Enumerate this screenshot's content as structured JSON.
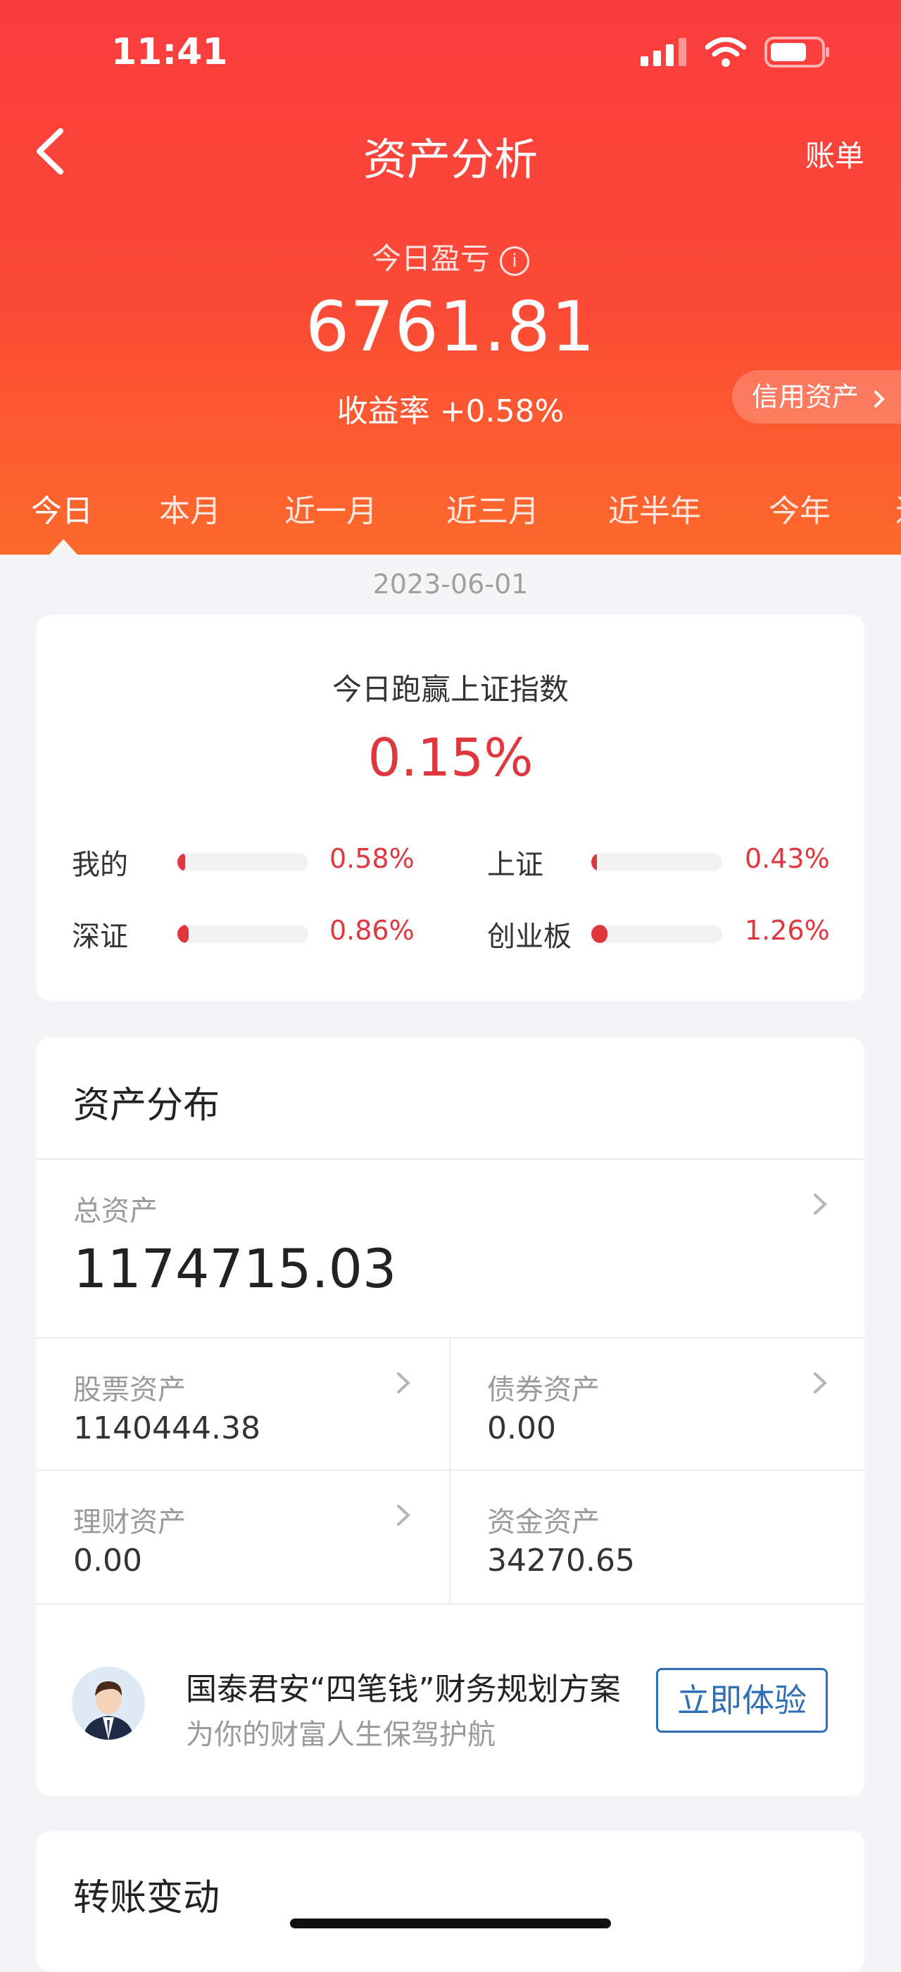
{
  "status_bar": {
    "time": "11:41"
  },
  "nav": {
    "title": "资产分析",
    "bill": "账单"
  },
  "summary": {
    "today_label": "今日盈亏",
    "info_glyph": "i",
    "today_value": "6761.81",
    "rate_text": "收益率 +0.58%",
    "credit_label": "信用资产"
  },
  "tabs": [
    {
      "label": "今日",
      "active": true
    },
    {
      "label": "本月"
    },
    {
      "label": "近一月"
    },
    {
      "label": "近三月"
    },
    {
      "label": "近半年"
    },
    {
      "label": "今年"
    },
    {
      "label": "近"
    }
  ],
  "date": "2023-06-01",
  "comparison": {
    "title": "今日跑赢上证指数",
    "value": "0.15%",
    "items": [
      {
        "label": "我的",
        "pct": "0.58%",
        "fill": 0.058
      },
      {
        "label": "上证",
        "pct": "0.43%",
        "fill": 0.043
      },
      {
        "label": "深证",
        "pct": "0.86%",
        "fill": 0.086
      },
      {
        "label": "创业板",
        "pct": "1.26%",
        "fill": 0.126
      }
    ]
  },
  "assets": {
    "title": "资产分布",
    "total_label": "总资产",
    "total_value": "1174715.03",
    "stock_label": "股票资产",
    "stock_value": "1140444.38",
    "bond_label": "债券资产",
    "bond_value": "0.00",
    "wealth_label": "理财资产",
    "wealth_value": "0.00",
    "cash_label": "资金资产",
    "cash_value": "34270.65",
    "promo": {
      "title": "国泰君安“四笔钱”财务规划方案",
      "subtitle": "为你的财富人生保驾护航",
      "button": "立即体验"
    }
  },
  "transfer": {
    "title": "转账变动"
  },
  "colors": {
    "header_top": "#f93c3e",
    "header_bottom": "#fc6a2c",
    "up_red": "#e0363e",
    "link_blue": "#2f6fb5"
  }
}
